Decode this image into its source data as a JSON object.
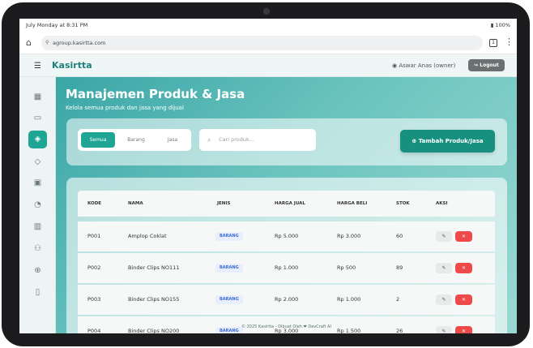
{
  "status": {
    "time": "July Monday at 8:31 PM",
    "battery": "100%"
  },
  "browser": {
    "url": "agroup.kasirtta.com",
    "tabs_count": "1"
  },
  "header": {
    "brand": "Kasirtta",
    "user": "Aswar Anas (owner)",
    "logout_label": "Logout"
  },
  "page": {
    "title": "Manajemen Produk & Jasa",
    "subtitle": "Kelola semua produk dan jasa yang dijual"
  },
  "filters": {
    "segments": [
      "Semua",
      "Barang",
      "Jasa"
    ],
    "selected": "Semua",
    "search_placeholder": "Cari produk...",
    "add_label": "Tambah Produk/Jasa"
  },
  "table": {
    "columns": [
      "KODE",
      "NAMA",
      "JENIS",
      "HARGA JUAL",
      "HARGA BELI",
      "STOK",
      "AKSI"
    ],
    "rows": [
      {
        "kode": "P001",
        "nama": "Amplop Coklat",
        "jenis": "BARANG",
        "harga_jual": "Rp 5.000",
        "harga_beli": "Rp 3.000",
        "stok": "60"
      },
      {
        "kode": "P002",
        "nama": "Binder Clips NO111",
        "jenis": "BARANG",
        "harga_jual": "Rp 1.000",
        "harga_beli": "Rp 500",
        "stok": "89"
      },
      {
        "kode": "P003",
        "nama": "Binder Clips NO155",
        "jenis": "BARANG",
        "harga_jual": "Rp 2.000",
        "harga_beli": "Rp 1.000",
        "stok": "2"
      },
      {
        "kode": "P004",
        "nama": "Binder Clips NO200",
        "jenis": "BARANG",
        "harga_jual": "Rp 3.000",
        "harga_beli": "Rp 1.500",
        "stok": "26"
      }
    ]
  },
  "footer": {
    "text": "© 2025 Kasirtta - Dibuat Oleh ❤ DevCraft AI"
  },
  "icons": {
    "sidebar": [
      "dashboard-icon",
      "pos-icon",
      "product-icon",
      "stock-icon",
      "purchase-icon",
      "history-icon",
      "report-icon",
      "users-icon",
      "settings-icon",
      "book-icon"
    ]
  },
  "colors": {
    "accent": "#1fa593",
    "brand": "#1f7f7a",
    "danger": "#ef4a4a",
    "badge": "#3b6fd6"
  }
}
